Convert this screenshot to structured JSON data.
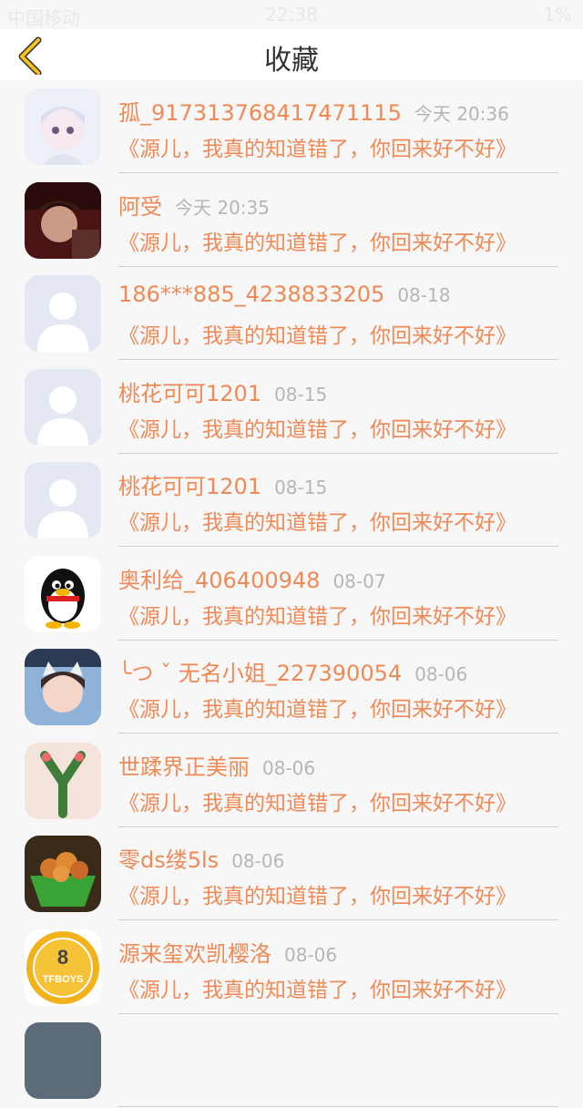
{
  "status_bar": {
    "carrier": "中国移动",
    "time": "22:38",
    "battery": "1%"
  },
  "nav": {
    "title": "收藏"
  },
  "colors": {
    "accent": "#ef8a56",
    "back_icon": "#f3c21c"
  },
  "favorites": [
    {
      "avatar": "anime-girl-avatar",
      "name": "孤_917313768417471115",
      "time": "今天 20:36",
      "title": "《源儿，我真的知道错了，你回来好不好》"
    },
    {
      "avatar": "boy-photo-avatar",
      "name": "阿受",
      "time": "今天 20:35",
      "title": "《源儿，我真的知道错了，你回来好不好》"
    },
    {
      "avatar": "default-person-avatar",
      "name": "186***885_4238833205",
      "time": "08-18",
      "title": "《源儿，我真的知道错了，你回来好不好》"
    },
    {
      "avatar": "default-person-avatar",
      "name": "桃花可可1201",
      "time": "08-15",
      "title": "《源儿，我真的知道错了，你回来好不好》"
    },
    {
      "avatar": "default-person-avatar",
      "name": "桃花可可1201",
      "time": "08-15",
      "title": "《源儿，我真的知道错了，你回来好不好》"
    },
    {
      "avatar": "penguin-avatar",
      "name": "奥利给_406400948",
      "time": "08-07",
      "title": "《源儿，我真的知道错了，你回来好不好》"
    },
    {
      "avatar": "cat-ear-boy-avatar",
      "name": "╰つ ˇ 无名小姐_227390054",
      "time": "08-06",
      "title": "《源儿，我真的知道错了，你回来好不好》"
    },
    {
      "avatar": "letter-y-avatar",
      "name": "世蹂界正美丽",
      "time": "08-06",
      "title": "《源儿，我真的知道错了，你回来好不好》"
    },
    {
      "avatar": "food-bowl-avatar",
      "name": "零ds缕5ls",
      "time": "08-06",
      "title": "《源儿，我真的知道错了，你回来好不好》"
    },
    {
      "avatar": "tfboys-badge-avatar",
      "name": "源来玺欢凯樱洛",
      "time": "08-06",
      "title": "《源儿，我真的知道错了，你回来好不好》",
      "badge_text": "TFBOYS"
    },
    {
      "avatar": "partial-avatar",
      "name": "",
      "time": "",
      "title": ""
    }
  ]
}
